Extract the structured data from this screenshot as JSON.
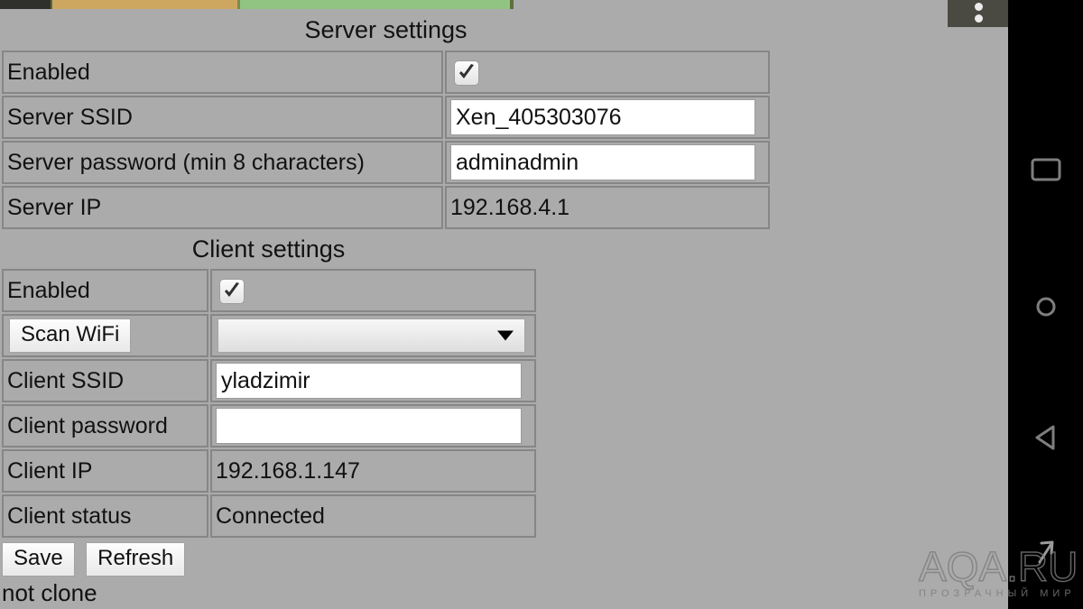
{
  "page": {
    "background_color": "#ababab",
    "status_text": "not clone"
  },
  "topstrip": {
    "segments": [
      "dark",
      "tan",
      "green"
    ],
    "colors": {
      "dark": "#2f302c",
      "tan": "#cda75f",
      "green": "#91c482"
    }
  },
  "server": {
    "title": "Server settings",
    "rows": [
      {
        "label": "Enabled",
        "value": "",
        "type": "checkbox",
        "checked": true
      },
      {
        "label": "Server SSID",
        "value": "Xen_405303076",
        "type": "text"
      },
      {
        "label": "Server password (min 8 characters)",
        "value": "adminadmin",
        "type": "text"
      },
      {
        "label": "Server IP",
        "value": "192.168.4.1",
        "type": "static"
      }
    ]
  },
  "client": {
    "title": "Client settings",
    "rows": [
      {
        "label": "Enabled",
        "value": "",
        "type": "checkbox",
        "checked": true
      },
      {
        "label": "Scan WiFi",
        "value": "",
        "type": "scan"
      },
      {
        "label": "Client SSID",
        "value": "yladzimir",
        "type": "text"
      },
      {
        "label": "Client password",
        "value": "",
        "type": "text"
      },
      {
        "label": "Client IP",
        "value": "192.168.1.147",
        "type": "static"
      },
      {
        "label": "Client status",
        "value": "Connected",
        "type": "static"
      }
    ],
    "scan_button_label": "Scan WiFi",
    "network_dropdown_value": ""
  },
  "buttons": {
    "save_label": "Save",
    "refresh_label": "Refresh"
  },
  "navbar": {
    "recents_label": "recents-square-icon",
    "home_label": "home-circle-icon",
    "back_label": "back-triangle-icon",
    "expand_label": "expand-chevron-icon"
  },
  "overflow": {
    "label": "overflow-menu-icon"
  },
  "watermark": {
    "main": "AQA.RU",
    "sub": "ПРОЗРАЧНЫЙ МИР"
  }
}
